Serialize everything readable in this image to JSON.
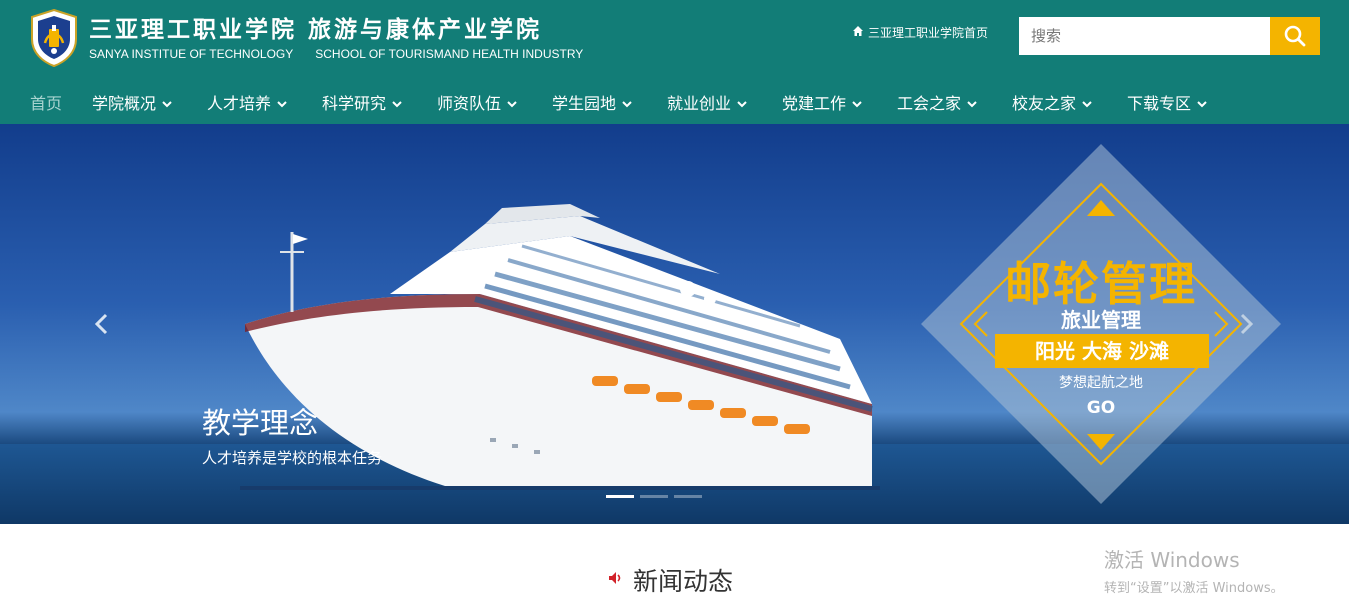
{
  "header": {
    "title_cn": "三亚理工职业学院  旅游与康体产业学院",
    "title_en_1": "SANYA INSTITUE OF TECHNOLOGY",
    "title_en_2": "SCHOOL OF TOURISMAND HEALTH INDUSTRY",
    "home_link": "三亚理工职业学院首页",
    "search_placeholder": "搜索",
    "accent_color": "#127d77",
    "search_button_color": "#f4b400"
  },
  "nav": {
    "items": [
      {
        "label": "首页",
        "active": true
      },
      {
        "label": "学院概况"
      },
      {
        "label": "人才培养"
      },
      {
        "label": "科学研究"
      },
      {
        "label": "师资队伍"
      },
      {
        "label": "学生园地"
      },
      {
        "label": "就业创业"
      },
      {
        "label": "党建工作"
      },
      {
        "label": "工会之家"
      },
      {
        "label": "校友之家"
      },
      {
        "label": "下载专区"
      }
    ]
  },
  "banner": {
    "caption_title": "教学理念",
    "caption_sub": "人才培养是学校的根本任务",
    "promo_title": "邮轮管理",
    "promo_sub1": "旅业管理",
    "promo_band": "阳光 大海 沙滩",
    "promo_sub2": "梦想起航之地",
    "promo_go": "GO",
    "prev_icon": "chevron-left-icon",
    "next_icon": "chevron-right-icon",
    "active_slide": 1,
    "slide_count": 3
  },
  "news": {
    "title": "新闻动态",
    "icon": "speaker-icon"
  },
  "windows_watermark": {
    "line1": "激活 Windows",
    "line2": "转到“设置”以激活 Windows。"
  }
}
